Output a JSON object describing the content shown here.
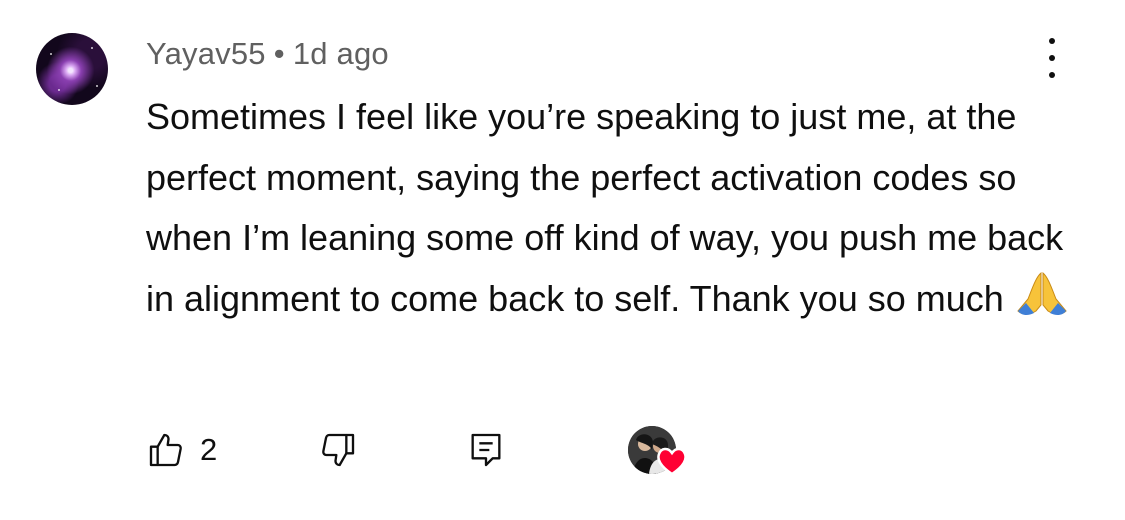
{
  "comment": {
    "author": "Yayav55",
    "separator": "•",
    "time": "1d ago",
    "text": "Sometimes I feel like you’re speaking to just me, at the perfect moment, saying the perfect activation codes so when I’m leaning some off kind of way, you push me back in alignment to come back to self. Thank you so much",
    "emoji": "folded-hands"
  },
  "actions": {
    "like_count": "2"
  },
  "icons": {
    "more": "more-vertical-icon",
    "like": "thumbs-up-icon",
    "dislike": "thumbs-down-icon",
    "reply": "comment-icon",
    "creator_heart": "heart-icon"
  },
  "colors": {
    "text": "#0f0f0f",
    "meta": "#606060",
    "heart": "#ff0033"
  }
}
